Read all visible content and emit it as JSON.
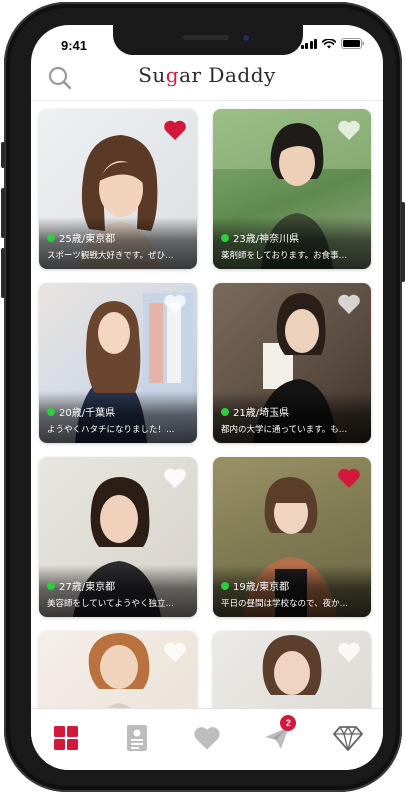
{
  "status_bar": {
    "time": "9:41"
  },
  "header": {
    "logo_part1": "Su",
    "logo_accent": "g",
    "logo_part2": "ar Daddy",
    "accent_color": "#d2193c"
  },
  "icons": {
    "search": "search-icon",
    "heart": "heart-icon",
    "grid": "grid-icon",
    "profile": "profile-card-icon",
    "paper_plane": "paper-plane-icon",
    "diamond": "diamond-icon"
  },
  "profiles": [
    {
      "age_location": "25歳/東京都",
      "message": "スポーツ観戦大好きです。ぜひ…",
      "online": true,
      "liked": true
    },
    {
      "age_location": "23歳/神奈川県",
      "message": "薬剤師をしております。お食事…",
      "online": true,
      "liked": false
    },
    {
      "age_location": "20歳/千葉県",
      "message": "ようやくハタチになりました！…",
      "online": true,
      "liked": false
    },
    {
      "age_location": "21歳/埼玉県",
      "message": "都内の大学に通っています。も…",
      "online": true,
      "liked": false
    },
    {
      "age_location": "27歳/東京都",
      "message": "美容師をしていてようやく独立…",
      "online": true,
      "liked": false
    },
    {
      "age_location": "19歳/東京都",
      "message": "平日の昼間は学校なので、夜か…",
      "online": true,
      "liked": true
    },
    {
      "age_location": "",
      "message": "",
      "online": false,
      "liked": false
    },
    {
      "age_location": "",
      "message": "",
      "online": false,
      "liked": false
    }
  ],
  "tabbar": {
    "active_tab": "grid",
    "messages_badge": "2"
  }
}
